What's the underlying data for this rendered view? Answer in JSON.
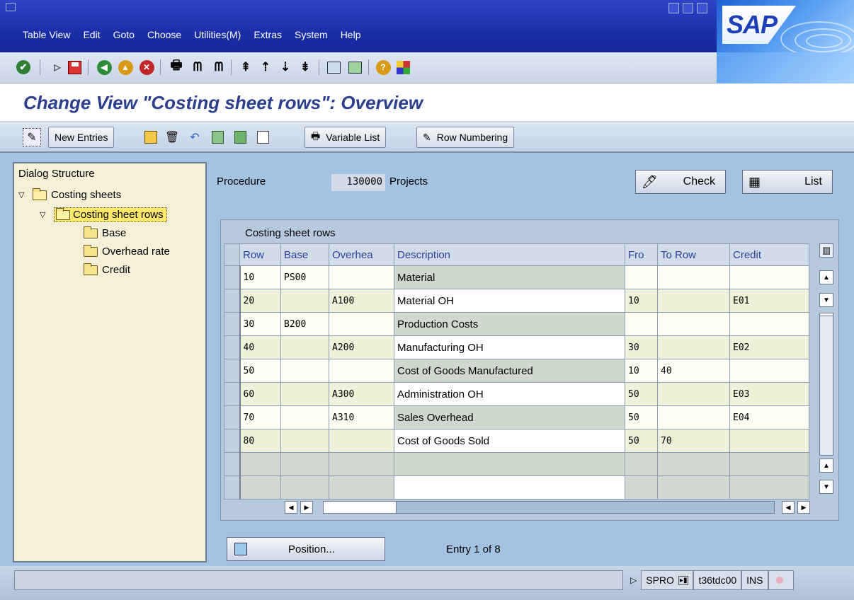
{
  "menu": {
    "items": [
      {
        "label": "Table View"
      },
      {
        "label": "Edit"
      },
      {
        "label": "Goto"
      },
      {
        "label": "Choose"
      },
      {
        "label": "Utilities(M)"
      },
      {
        "label": "Extras"
      },
      {
        "label": "System"
      },
      {
        "label": "Help"
      }
    ],
    "logo_text": "SAP"
  },
  "screen": {
    "title": "Change View \"Costing sheet rows\": Overview"
  },
  "app_toolbar": {
    "new_entries": "New Entries",
    "variable_list": "Variable List",
    "row_numbering": "Row Numbering"
  },
  "dialog_structure": {
    "title": "Dialog Structure",
    "nodes": [
      {
        "label": "Costing sheets"
      },
      {
        "label": "Costing sheet rows"
      },
      {
        "label": "Base"
      },
      {
        "label": "Overhead rate"
      },
      {
        "label": "Credit"
      }
    ]
  },
  "header_fields": {
    "procedure_label": "Procedure",
    "procedure_value": "130000",
    "procedure_desc": "Projects",
    "check": "Check",
    "list": "List"
  },
  "table": {
    "title": "Costing sheet rows",
    "columns": [
      "Row",
      "Base",
      "Overhea",
      "Description",
      "Fro",
      "To Row",
      "Credit"
    ],
    "rows": [
      [
        "10",
        "PS00",
        "",
        "Material",
        "",
        "",
        ""
      ],
      [
        "20",
        "",
        "A100",
        "Material OH",
        "10",
        "",
        "E01"
      ],
      [
        "30",
        "B200",
        "",
        "Production Costs",
        "",
        "",
        ""
      ],
      [
        "40",
        "",
        "A200",
        "Manufacturing OH",
        "30",
        "",
        "E02"
      ],
      [
        "50",
        "",
        "",
        "Cost of Goods Manufactured",
        "10",
        "40",
        ""
      ],
      [
        "60",
        "",
        "A300",
        "Administration OH",
        "50",
        "",
        "E03"
      ],
      [
        "70",
        "",
        "A310",
        "Sales Overhead",
        "50",
        "",
        "E04"
      ],
      [
        "80",
        "",
        "",
        "Cost of Goods Sold",
        "50",
        "70",
        ""
      ]
    ]
  },
  "footer": {
    "position": "Position...",
    "entry_info": "Entry 1 of 8"
  },
  "status": {
    "transaction": "SPRO",
    "server": "t36tdc00",
    "mode": "INS"
  },
  "colors": {
    "menubar": "#1a2fa8",
    "title_text": "#2a3e8c",
    "main_bg": "#a4c3e2",
    "tree_bg": "#f5f0d7"
  }
}
